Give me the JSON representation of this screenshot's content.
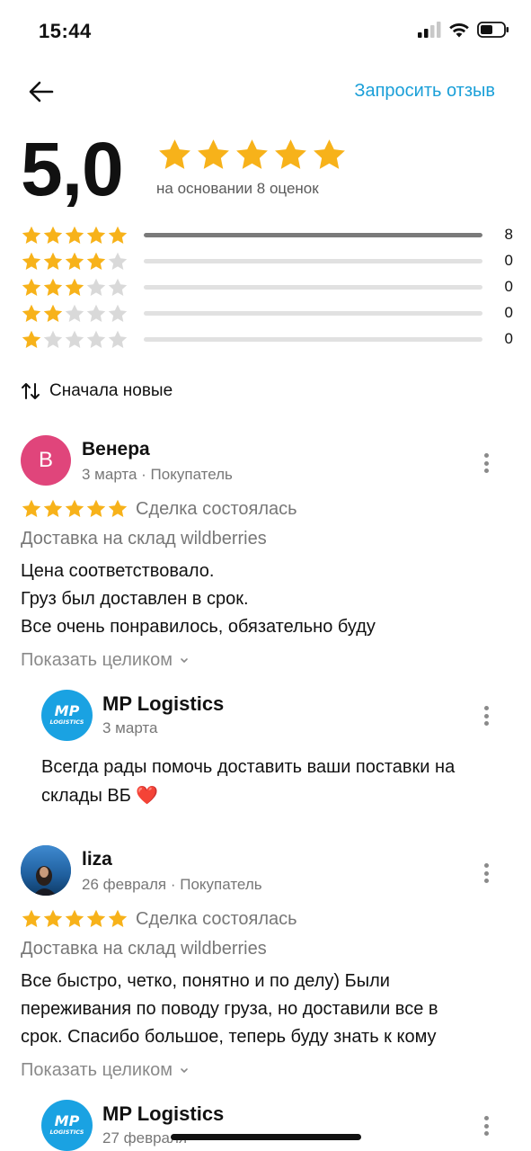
{
  "status_bar": {
    "time": "15:44"
  },
  "header": {
    "request_review_label": "Запросить отзыв"
  },
  "summary": {
    "rating_value": "5,0",
    "rating": 5,
    "basis_text": "на основании 8 оценок",
    "distribution": [
      {
        "stars": 5,
        "count": "8",
        "fraction": 1.0
      },
      {
        "stars": 4,
        "count": "0",
        "fraction": 0
      },
      {
        "stars": 3,
        "count": "0",
        "fraction": 0
      },
      {
        "stars": 2,
        "count": "0",
        "fraction": 0
      },
      {
        "stars": 1,
        "count": "0",
        "fraction": 0
      }
    ]
  },
  "sort": {
    "label": "Сначала новые"
  },
  "reviews": [
    {
      "avatar_letter": "В",
      "avatar_color": "#e0457b",
      "name": "Венера",
      "meta": "3 марта · Покупатель",
      "rating": 5,
      "deal_status": "Сделка состоялась",
      "delivery": "Доставка на склад wildberries",
      "text": [
        "Цена соответствовало.",
        "Груз был доставлен в срок.",
        "Все очень понравилось, обязательно буду"
      ],
      "show_full": "Показать целиком",
      "reply": {
        "logo_top": "MP",
        "logo_bottom": "LOGISTICS",
        "name": "MP Logistics",
        "date": "3 марта",
        "text": [
          "Всегда рады помочь доставить ваши поставки на",
          "склады ВБ ❤️"
        ]
      }
    },
    {
      "name": "liza",
      "meta": "26 февраля · Покупатель",
      "rating": 5,
      "deal_status": "Сделка состоялась",
      "delivery": "Доставка на склад wildberries",
      "text": [
        "Все быстро, четко, понятно и по делу) Были",
        "переживания по поводу груза, но доставили все в",
        "срок. Спасибо большое, теперь буду знать к кому"
      ],
      "show_full": "Показать целиком",
      "reply": {
        "logo_top": "MP",
        "logo_bottom": "LOGISTICS",
        "name": "MP Logistics",
        "date": "27 февраля"
      }
    }
  ],
  "colors": {
    "accent": "#1a9fd8",
    "star": "#f7b21a",
    "star_empty": "#d9d9d9",
    "logo_bg": "#1aa2e2"
  }
}
